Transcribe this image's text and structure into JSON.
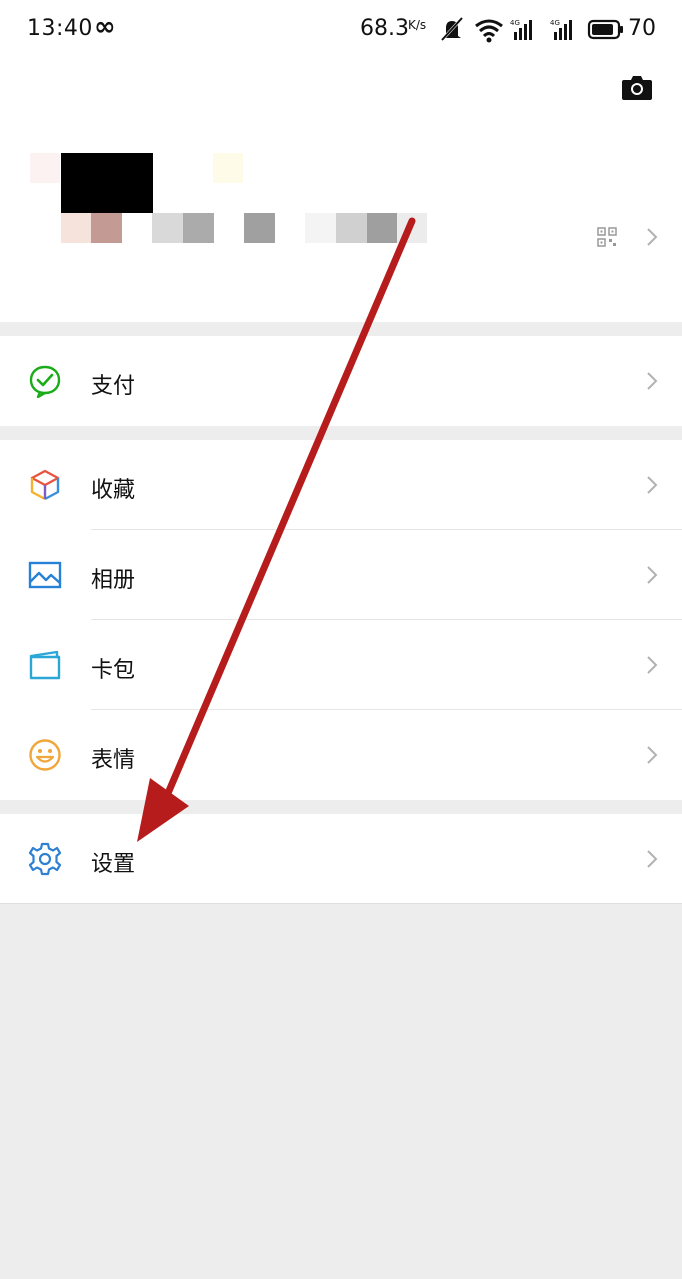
{
  "status_bar": {
    "time": "13:40",
    "infinity": "∞",
    "net_speed": "68.3",
    "net_speed_unit": "K/s",
    "battery": "70"
  },
  "menu": {
    "pay": "支付",
    "favorites": "收藏",
    "album": "相册",
    "cards": "卡包",
    "stickers": "表情",
    "settings": "设置"
  },
  "colors": {
    "arrow": "#b71c1c",
    "pay_icon": "#1aad19",
    "album_icon": "#2782d7",
    "cards_icon": "#2aa7d6",
    "stickers_icon": "#f0a63a",
    "settings_icon": "#2f80d1"
  },
  "icons": [
    "camera-icon",
    "qr-code-icon",
    "chevron-right-icon",
    "pay-icon",
    "favorites-icon",
    "album-icon",
    "cards-icon",
    "stickers-icon",
    "settings-icon"
  ]
}
